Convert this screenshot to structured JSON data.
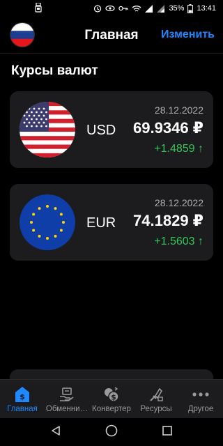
{
  "status_bar": {
    "time": "13:41",
    "battery": "35%",
    "icons": [
      "usb-icon",
      "alarm-icon",
      "eye-icon",
      "key-icon",
      "wifi-icon",
      "signal-icon",
      "signal-icon",
      "battery-icon"
    ]
  },
  "header": {
    "title": "Главная",
    "action_label": "Изменить",
    "flag_icon": "russia-flag-icon"
  },
  "section_title": "Курсы валют",
  "currencies": [
    {
      "code": "USD",
      "date": "28.12.2022",
      "rate": "69.9346 ₽",
      "change": "+1.4859 ↑",
      "flag_icon": "usa-flag-icon"
    },
    {
      "code": "EUR",
      "date": "28.12.2022",
      "rate": "74.1829 ₽",
      "change": "+1.5603 ↑",
      "flag_icon": "eu-flag-icon"
    }
  ],
  "tabs": [
    {
      "label": "Главная",
      "icon": "home-dollar-icon",
      "active": true
    },
    {
      "label": "Обменни…",
      "icon": "exchange-office-icon",
      "active": false
    },
    {
      "label": "Конвертер",
      "icon": "converter-icon",
      "active": false
    },
    {
      "label": "Ресурсы",
      "icon": "resources-icon",
      "active": false
    },
    {
      "label": "Другое",
      "icon": "more-icon",
      "active": false
    }
  ],
  "nav_bar": {
    "icons": [
      "back-icon",
      "home-icon",
      "recents-icon"
    ]
  },
  "colors": {
    "accent": "#1e88ff",
    "positive": "#34c759",
    "card_bg": "#1c1c1e",
    "background": "#000000"
  }
}
